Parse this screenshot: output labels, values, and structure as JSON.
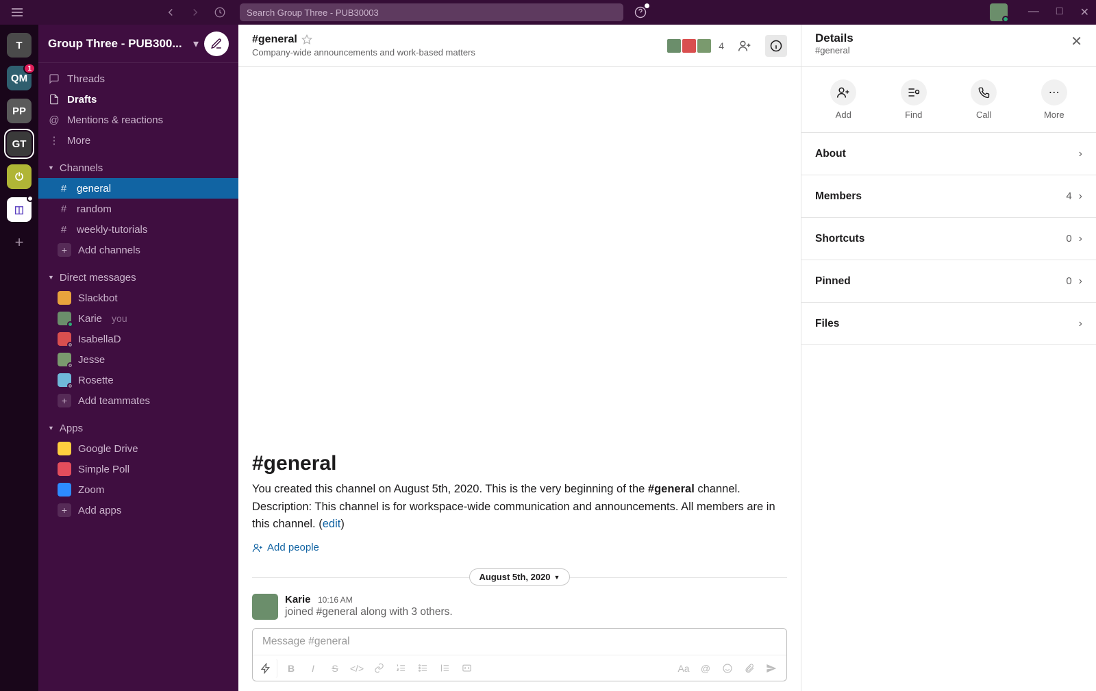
{
  "titlebar": {
    "search_placeholder": "Search Group Three - PUB30003",
    "window_controls": {
      "min": "—",
      "max": "□",
      "close": "✕"
    }
  },
  "rail": {
    "workspaces": [
      {
        "id": "ws-t",
        "label": "T",
        "bg": "#4a4a4a"
      },
      {
        "id": "ws-qm",
        "label": "QM",
        "bg": "#2f5f6f",
        "badge": "1"
      },
      {
        "id": "ws-pp",
        "label": "PP",
        "bg": "#5a5a5a"
      },
      {
        "id": "ws-gt",
        "label": "GT",
        "bg": "#3a3a3a",
        "selected": true
      },
      {
        "id": "ws-power",
        "label": "",
        "bg": "#b0b536",
        "icon": "⏻"
      },
      {
        "id": "ws-app",
        "label": "",
        "bg": "#ffffff",
        "icon": "◫",
        "dot": true
      }
    ]
  },
  "sidebar": {
    "workspace_name": "Group Three - PUB300...",
    "nav": {
      "threads": "Threads",
      "drafts": "Drafts",
      "mentions": "Mentions & reactions",
      "more": "More"
    },
    "channels_header": "Channels",
    "channels": [
      {
        "name": "general",
        "selected": true
      },
      {
        "name": "random"
      },
      {
        "name": "weekly-tutorials"
      }
    ],
    "add_channels": "Add channels",
    "dms_header": "Direct messages",
    "dms": [
      {
        "name": "Slackbot",
        "color": "#e8a33d",
        "icon": true
      },
      {
        "name": "Karie",
        "you": "you",
        "color": "#6b8e6b",
        "presence": "active"
      },
      {
        "name": "IsabellaD",
        "color": "#d94f4f",
        "presence": "away"
      },
      {
        "name": "Jesse",
        "color": "#7a9a6e",
        "presence": "away"
      },
      {
        "name": "Rosette",
        "color": "#6fb8d9",
        "presence": "away"
      }
    ],
    "add_teammates": "Add teammates",
    "apps_header": "Apps",
    "apps": [
      {
        "name": "Google Drive",
        "color": "#ffcf3f"
      },
      {
        "name": "Simple Poll",
        "color": "#e34d5c"
      },
      {
        "name": "Zoom",
        "color": "#2d8cff"
      }
    ],
    "add_apps": "Add apps"
  },
  "channel": {
    "name": "#general",
    "topic": "Company-wide announcements and work-based matters",
    "member_count": "4",
    "intro": {
      "big_name": "#general",
      "line1": "You created this channel on August 5th, 2020. This is the very beginning of the ",
      "bold": "#general",
      "line2": " channel. Description: This channel is for workspace-wide communication and announcements. All members are in this channel. (",
      "edit": "edit",
      "line3": ")"
    },
    "add_people": "Add people",
    "date_pill": "August 5th, 2020",
    "message": {
      "author": "Karie",
      "time": "10:16 AM",
      "text": "joined #general along with 3 others."
    },
    "composer_placeholder": "Message #general"
  },
  "panel": {
    "title": "Details",
    "subtitle": "#general",
    "actions": {
      "add": "Add",
      "find": "Find",
      "call": "Call",
      "more": "More"
    },
    "rows": {
      "about": "About",
      "members": "Members",
      "members_count": "4",
      "shortcuts": "Shortcuts",
      "shortcuts_count": "0",
      "pinned": "Pinned",
      "pinned_count": "0",
      "files": "Files"
    }
  }
}
